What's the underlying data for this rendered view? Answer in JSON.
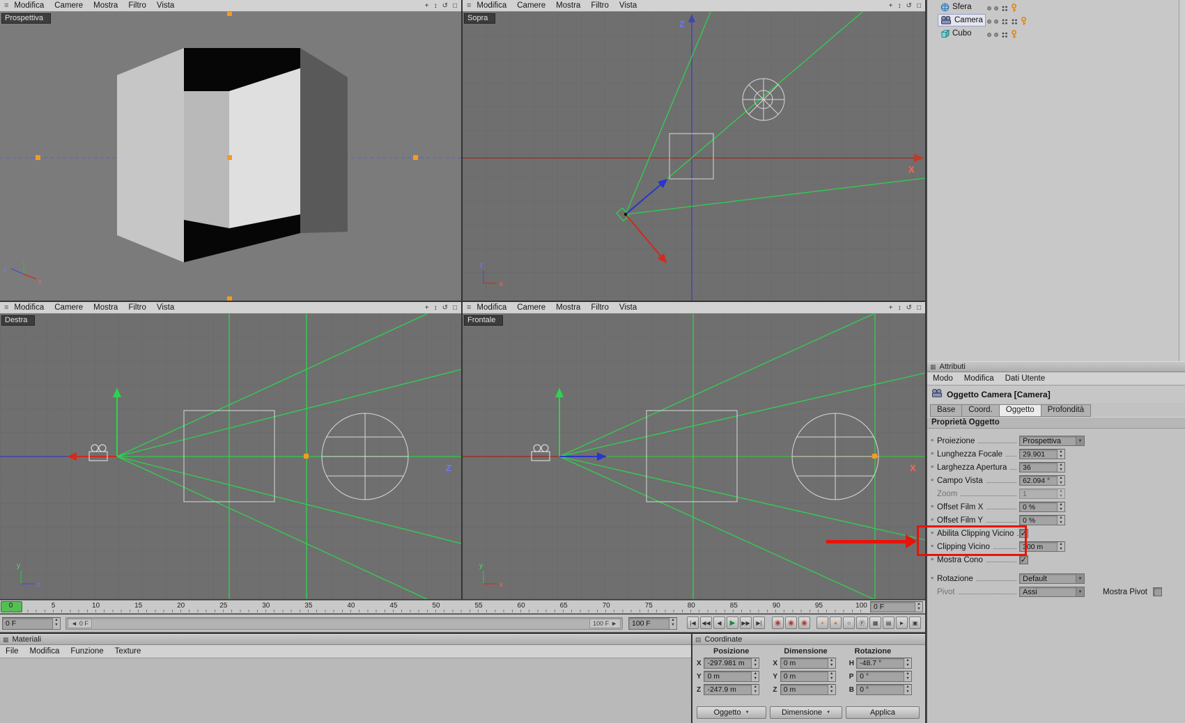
{
  "viewport_menu": {
    "items": [
      "Modifica",
      "Camere",
      "Mostra",
      "Filtro",
      "Vista"
    ],
    "corner_icons": [
      "pan-icon",
      "zoom-icon",
      "rotate-icon",
      "maximize-icon"
    ]
  },
  "viewports": {
    "perspective": "Prospettiva",
    "top": "Sopra",
    "right": "Destra",
    "front": "Frontale"
  },
  "axes": {
    "X": "X",
    "Z": "Z",
    "x": "x",
    "y": "y",
    "z": "z"
  },
  "timeline": {
    "ticks": [
      "0",
      "5",
      "10",
      "15",
      "20",
      "25",
      "30",
      "35",
      "40",
      "45",
      "50",
      "55",
      "60",
      "65",
      "70",
      "75",
      "80",
      "85",
      "90",
      "95",
      "100"
    ],
    "ruler_field": "0 F",
    "start_field": "0 F",
    "slider_start": "0 F",
    "slider_end": "100 F",
    "end_field": "100 F",
    "transport": [
      "goto-start",
      "prev-key",
      "prev-frame",
      "play",
      "next-frame",
      "goto-end"
    ],
    "record_buttons": [
      "record-position",
      "record-scale",
      "record-rotation"
    ],
    "tool_buttons": [
      "autokey",
      "key",
      "circle",
      "pla",
      "grid-a",
      "grid-b",
      "cursor",
      "layout"
    ]
  },
  "materials": {
    "title": "Materiali",
    "menus": [
      "File",
      "Modifica",
      "Funzione",
      "Texture"
    ]
  },
  "coordinates": {
    "title": "Coordinate",
    "columns": [
      "Posizione",
      "Dimensione",
      "Rotazione"
    ],
    "rows": [
      {
        "pos_label": "X",
        "pos": "-297.981 m",
        "dim_label": "X",
        "dim": "0 m",
        "rot_label": "H",
        "rot": "-48.7 °"
      },
      {
        "pos_label": "Y",
        "pos": "0 m",
        "dim_label": "Y",
        "dim": "0 m",
        "rot_label": "P",
        "rot": "0 °"
      },
      {
        "pos_label": "Z",
        "pos": "-247.9 m",
        "dim_label": "Z",
        "dim": "0 m",
        "rot_label": "B",
        "rot": "0 °"
      }
    ],
    "buttons": [
      "Oggetto",
      "Dimensione",
      "Applica"
    ]
  },
  "object_manager": {
    "items": [
      {
        "name": "Sfera",
        "icon": "sphere-icon",
        "selected": false
      },
      {
        "name": "Camera",
        "icon": "camera-icon",
        "selected": true
      },
      {
        "name": "Cubo",
        "icon": "cube-icon",
        "selected": false
      }
    ]
  },
  "attributes": {
    "title": "Attributi",
    "menus": [
      "Modo",
      "Modifica",
      "Dati Utente"
    ],
    "object_title": "Oggetto Camera [Camera]",
    "tabs": [
      "Base",
      "Coord.",
      "Oggetto",
      "Profondità"
    ],
    "active_tab": "Oggetto",
    "section": "Proprietà Oggetto",
    "rows": [
      {
        "label": "Proiezione",
        "type": "dropdown",
        "value": "Prospettiva"
      },
      {
        "label": "Lunghezza Focale",
        "type": "spinner",
        "value": "29.901"
      },
      {
        "label": "Larghezza Apertura",
        "type": "spinner",
        "value": "36"
      },
      {
        "label": "Campo Vista",
        "type": "spinner",
        "value": "62.094 °"
      },
      {
        "label": "Zoom",
        "type": "spinner",
        "value": "1",
        "disabled": true,
        "bullet": false
      },
      {
        "label": "Offset Film X",
        "type": "spinner",
        "value": "0 %"
      },
      {
        "label": "Offset Film Y",
        "type": "spinner",
        "value": "0 %"
      },
      {
        "label": "Abilita Clipping Vicino",
        "type": "checkbox",
        "checked": true,
        "highlight": true
      },
      {
        "label": "Clipping Vicino",
        "type": "spinner",
        "value": "300 m",
        "highlight": true
      },
      {
        "label": "Mostra Cono",
        "type": "checkbox",
        "checked": true
      },
      {
        "label": "Rotazione",
        "type": "dropdown",
        "value": "Default",
        "gap_before": true
      },
      {
        "label": "Pivot",
        "type": "dropdown",
        "value": "Assi",
        "disabled_label": true,
        "bullet": false,
        "extra_label": "Mostra Pivot",
        "extra_checked": false
      }
    ]
  },
  "icons": {
    "pan-icon": "+",
    "zoom-icon": "↕",
    "rotate-icon": "↺",
    "maximize-icon": "□",
    "grip-icon": "≡",
    "bullet": "∘",
    "check-icon": "✓",
    "stepper-up": "▲",
    "stepper-down": "▼",
    "dropdown-arrow": "▼",
    "slider-left-arrow": "◄",
    "slider-right-arrow": "►",
    "goto-start-icon": "|◀",
    "prev-key-icon": "◀◀",
    "prev-frame-icon": "◀",
    "play-icon": "▶",
    "next-frame-icon": "▶▶",
    "goto-end-icon": "▶|",
    "record-position-icon": "◉",
    "record-scale-icon": "◉",
    "record-rotation-icon": "◉",
    "autokey-icon": "+",
    "key-icon": "●",
    "circle-icon": "○",
    "pla-icon": "Ⓟ",
    "grid-a-icon": "▦",
    "grid-b-icon": "▤",
    "cursor-icon": "►",
    "layout-icon": "▣"
  },
  "colors": {
    "frustum_green": "#2fd24f",
    "handle_orange": "#f59a23",
    "axis_red": "#c0392b",
    "axis_blue": "#3d46b0",
    "annotation_red": "#e81309"
  },
  "annotation": {
    "color": "#e81309"
  }
}
